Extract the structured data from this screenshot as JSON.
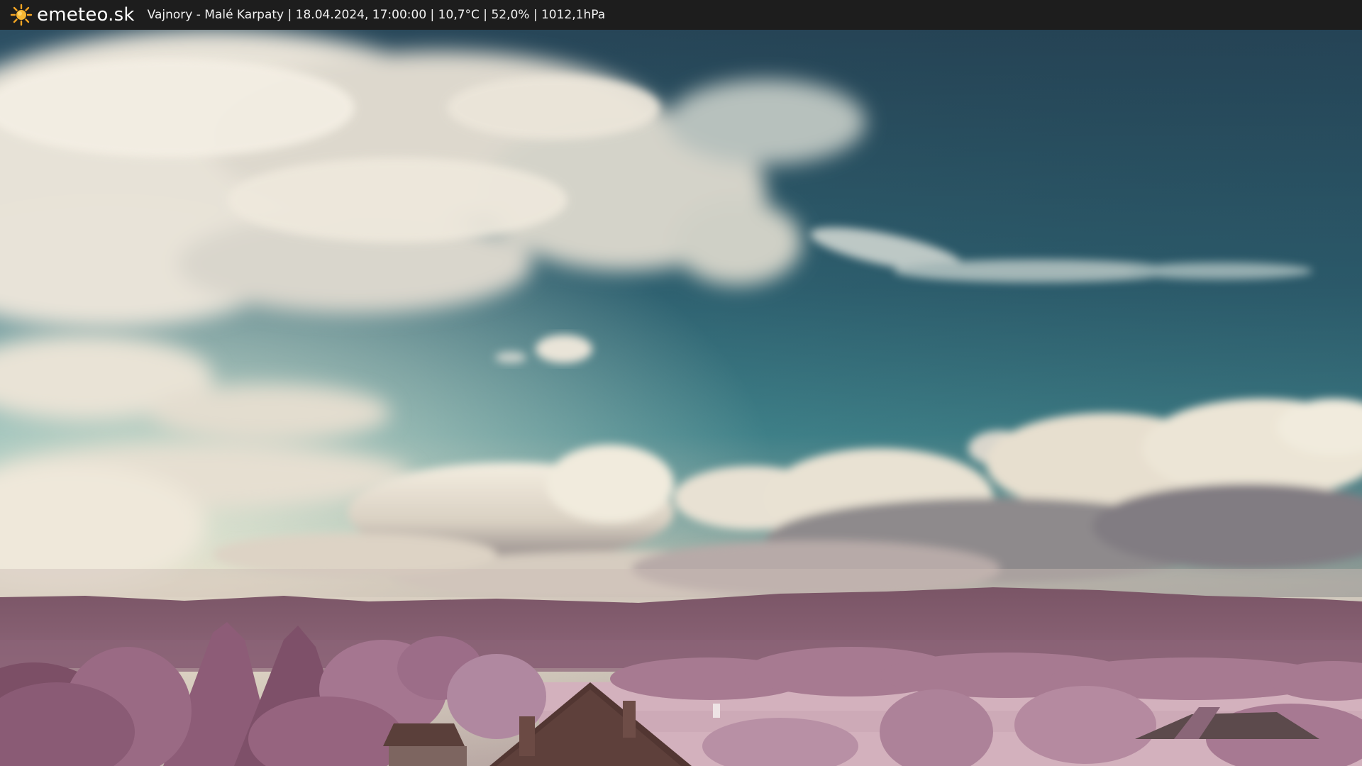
{
  "header": {
    "logo_icon": "sun-icon",
    "brand": "emeteo.sk",
    "location": "Vajnory - Malé Karpaty",
    "datetime": "18.04.2024, 17:00:00",
    "temperature": "10,7°C",
    "humidity": "52,0%",
    "pressure": "1012,1hPa",
    "caption": "Vajnory - Malé Karpaty | 18.04.2024, 17:00:00 | 10,7°C | 52,0% | 1012,1hPa"
  },
  "colors": {
    "bar_bg": "#1d1d1d",
    "sun": "#f5a623",
    "sky_top": "#2f5466",
    "sky_mid": "#3f8790",
    "cloud": "#f2ecdf",
    "foliage": "#9a6a84",
    "field": "#d8b6c0",
    "roof": "#5b3b35"
  }
}
